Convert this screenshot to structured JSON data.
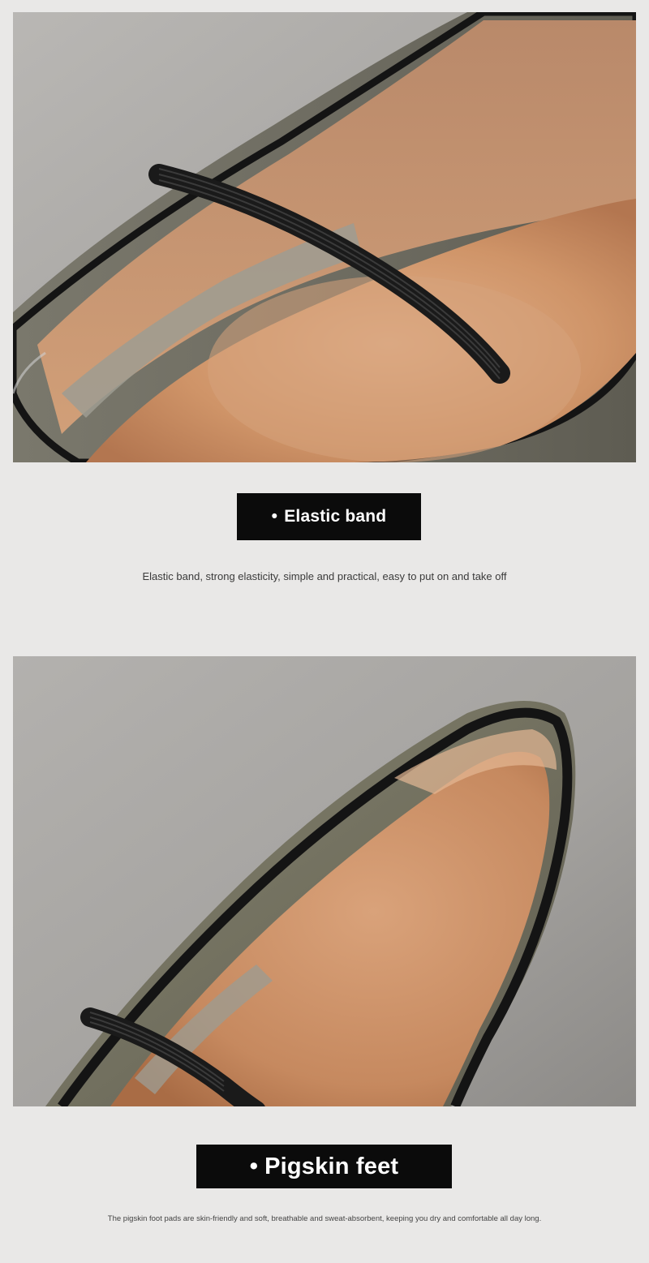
{
  "sections": [
    {
      "image_alt": "Close-up of grey pony-hair flat shoe with black elastic band across the instep",
      "label_bullet": "•",
      "label": "Elastic band",
      "description": "Elastic band, strong elasticity, simple and practical, easy to put on and take off"
    },
    {
      "image_alt": "Close-up of shoe toe showing tan pigskin lining and black piping",
      "label_bullet": "•",
      "label": "Pigskin feet",
      "description": "The pigskin foot pads are skin-friendly and soft, breathable and sweat-absorbent, keeping you dry and comfortable all day long."
    }
  ],
  "colors": {
    "background": "#e9e8e7",
    "label_background": "#0b0b0b",
    "label_text": "#ffffff",
    "leather_lining": "#c98d62",
    "pony_hair_grey": "#6e6c60",
    "trim_black": "#141414"
  }
}
